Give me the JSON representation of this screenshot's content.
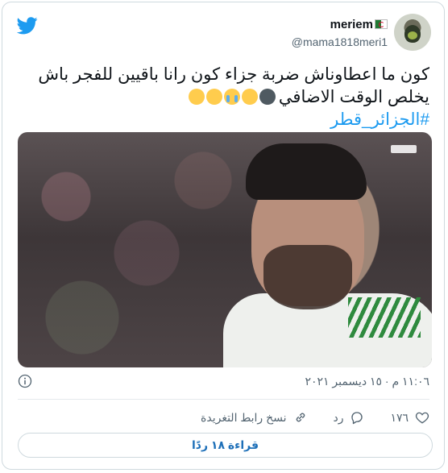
{
  "header": {
    "display_name": "meriem",
    "handle": "@mama1818meri1"
  },
  "tweet": {
    "text": "كون ما اعطاوناش ضربة جزاء كون رانا باقيين للفجر باش يخلص الوقت الاضافي",
    "emojis": [
      "new-moon-face",
      "joy",
      "loudly-crying",
      "joy",
      "joy"
    ],
    "hashtag": "#الجزائر_قطر"
  },
  "meta": {
    "timestamp": "١١:٠٦ م · ١٥ ديسمبر ٢٠٢١"
  },
  "actions": {
    "like_count": "١٧٦",
    "reply_label": "رد",
    "copy_link_label": "نسخ رابط التغريدة"
  },
  "read_replies_label": "قراءة ١٨ ردًا",
  "colors": {
    "twitter_blue": "#1d9bf0",
    "text_primary": "#0f1419",
    "text_secondary": "#536471",
    "border": "#cfd9de"
  }
}
